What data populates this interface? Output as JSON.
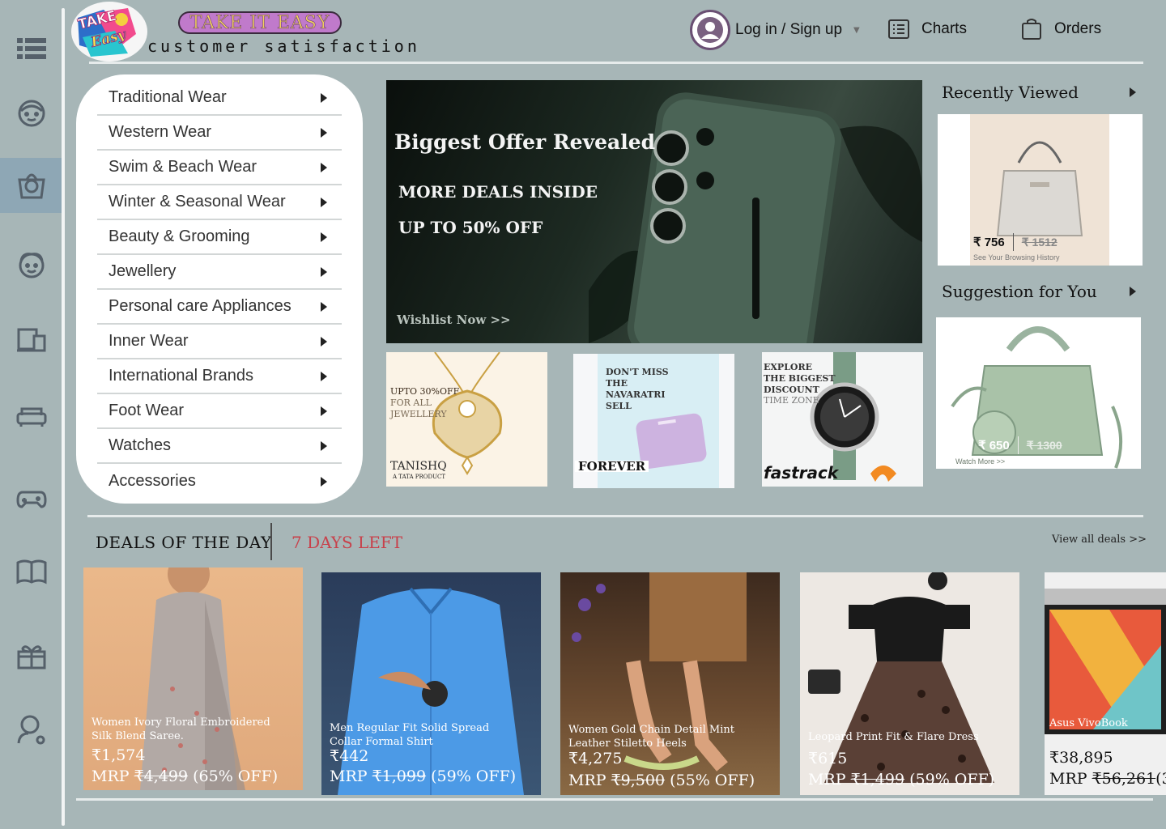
{
  "header": {
    "logo_text": "Take It Easy",
    "brand_name": "TAKE IT EASY",
    "tagline": "customer satisfaction",
    "login_label": "Log in / Sign up",
    "charts_label": "Charts",
    "orders_label": "Orders"
  },
  "sidebar_icons": [
    "menu-list-icon",
    "face-icon",
    "shopping-bag-icon",
    "kid-face-icon",
    "devices-icon",
    "sofa-icon",
    "gamepad-icon",
    "book-icon",
    "gift-icon",
    "search-user-icon"
  ],
  "categories": [
    "Traditional Wear",
    "Western Wear",
    "Swim & Beach Wear",
    "Winter & Seasonal Wear",
    "Beauty & Grooming",
    "Jewellery",
    "Personal care Appliances",
    "Inner Wear",
    "International Brands",
    "Foot Wear",
    "Watches",
    "Accessories"
  ],
  "hero": {
    "title": "Biggest Offer Revealed",
    "line1": "MORE DEALS INSIDE",
    "line2": "UP TO 50% OFF",
    "cta": "Wishlist Now  >>"
  },
  "promos": {
    "jewellery": {
      "text": "UPTO 30%OFF",
      "sub": "FOR ALL JEWELLERY",
      "brand": "TANISHQ",
      "brand_sub": "A TATA PRODUCT"
    },
    "wallet": {
      "text": "DON'T MISS THE NAVARATRI SELL",
      "brand": "FOREVER"
    },
    "watch": {
      "text": "EXPLORE THE BIGGEST DISCOUNT",
      "sub": "TIME ZONE",
      "brand": "fastrack"
    }
  },
  "recently_viewed": {
    "title": "Recently Viewed",
    "price": "₹ 756",
    "old_price": "₹ 1512",
    "note": "See Your Browsing History"
  },
  "suggestion": {
    "title": "Suggestion for You",
    "price": "₹ 650",
    "old_price": "₹ 1300",
    "note": "Watch More >>"
  },
  "deals": {
    "title": "DEALS OF THE DAY",
    "days_left": "7 DAYS LEFT",
    "view_all": "View all deals   >>",
    "items": [
      {
        "name": "Women Ivory Floral Embroidered Silk Blend Saree.",
        "price": "₹1,574",
        "mrp_label": "MRP",
        "mrp": "₹4,499",
        "off": "(65% OFF)"
      },
      {
        "name": "Men Regular Fit Solid Spread Collar Formal Shirt",
        "price": "₹442",
        "mrp_label": "MRP",
        "mrp": "₹1,099",
        "off": "(59% OFF)"
      },
      {
        "name": "Women Gold Chain Detail Mint Leather Stiletto Heels",
        "price": "₹4,275",
        "mrp_label": "MRP",
        "mrp": "₹9,500",
        "off": "(55% OFF)"
      },
      {
        "name": "Leopard Print Fit & Flare Dress",
        "price": "₹615",
        "mrp_label": "MRP",
        "mrp": "₹1,499",
        "off": "(59% OFF)"
      },
      {
        "name": "Asus VivoBook",
        "price": "₹38,895",
        "mrp_label": "MRP",
        "mrp": "₹56,261",
        "off": "(3"
      }
    ]
  }
}
